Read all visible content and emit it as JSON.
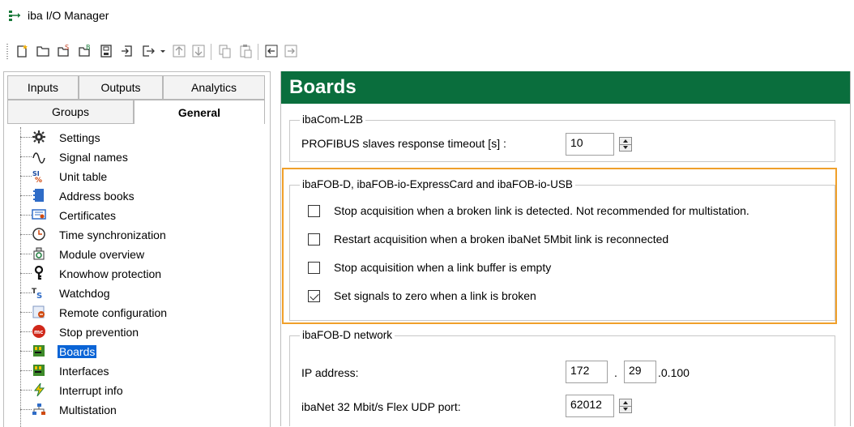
{
  "window": {
    "title": "iba I/O Manager",
    "icon": "io-manager-icon"
  },
  "toolbar": {
    "buttons": [
      {
        "name": "new-icon"
      },
      {
        "name": "open-icon"
      },
      {
        "name": "open-s-icon"
      },
      {
        "name": "open-b-icon"
      },
      {
        "name": "save-icon"
      },
      {
        "name": "import-icon"
      },
      {
        "name": "export-icon"
      },
      {
        "name": "move-up-icon"
      },
      {
        "name": "move-down-icon"
      },
      {
        "name": "copy-icon"
      },
      {
        "name": "paste-icon"
      },
      {
        "name": "back-icon"
      },
      {
        "name": "forward-icon"
      }
    ]
  },
  "tabs": {
    "row1": [
      "Inputs",
      "Outputs",
      "Analytics"
    ],
    "row2": [
      "Groups",
      "General"
    ],
    "active": "General"
  },
  "tree": {
    "items": [
      {
        "label": "Settings",
        "icon": "gear-icon"
      },
      {
        "label": "Signal names",
        "icon": "signal-wave-icon"
      },
      {
        "label": "Unit table",
        "icon": "unit-table-icon"
      },
      {
        "label": "Address books",
        "icon": "address-book-icon"
      },
      {
        "label": "Certificates",
        "icon": "certificate-icon"
      },
      {
        "label": "Time synchronization",
        "icon": "clock-icon"
      },
      {
        "label": "Module overview",
        "icon": "module-overview-icon"
      },
      {
        "label": "Knowhow protection",
        "icon": "key-icon"
      },
      {
        "label": "Watchdog",
        "icon": "watchdog-icon"
      },
      {
        "label": "Remote configuration",
        "icon": "remote-config-icon"
      },
      {
        "label": "Stop prevention",
        "icon": "stop-prevention-icon"
      },
      {
        "label": "Boards",
        "icon": "board-icon",
        "selected": true
      },
      {
        "label": "Interfaces",
        "icon": "interfaces-icon"
      },
      {
        "label": "Interrupt info",
        "icon": "interrupt-icon"
      },
      {
        "label": "Multistation",
        "icon": "multistation-icon"
      }
    ]
  },
  "main": {
    "header": "Boards",
    "header_color": "#0a6e3d",
    "group_l2b": {
      "title": "ibaCom-L2B",
      "timeout_label": "PROFIBUS slaves response timeout [s] :",
      "timeout_value": "10"
    },
    "group_fob": {
      "title": "ibaFOB-D, ibaFOB-io-ExpressCard and ibaFOB-io-USB",
      "options": [
        {
          "label": "Stop acquisition when a broken link is detected. Not recommended for multistation.",
          "checked": false
        },
        {
          "label": "Restart acquisition when a broken ibaNet 5Mbit link is reconnected",
          "checked": false
        },
        {
          "label": "Stop acquisition when a link buffer is empty",
          "checked": false
        },
        {
          "label": "Set signals to zero when a link is broken",
          "checked": true
        }
      ],
      "highlight_color": "#f0a02a"
    },
    "group_network": {
      "title": "ibaFOB-D network",
      "ip_label": "IP address:",
      "ip_octet1": "172",
      "ip_dot": ".",
      "ip_octet2": "29",
      "ip_rest": ".0.100",
      "port_label": "ibaNet 32 Mbit/s Flex UDP port:",
      "port_value": "62012"
    }
  }
}
